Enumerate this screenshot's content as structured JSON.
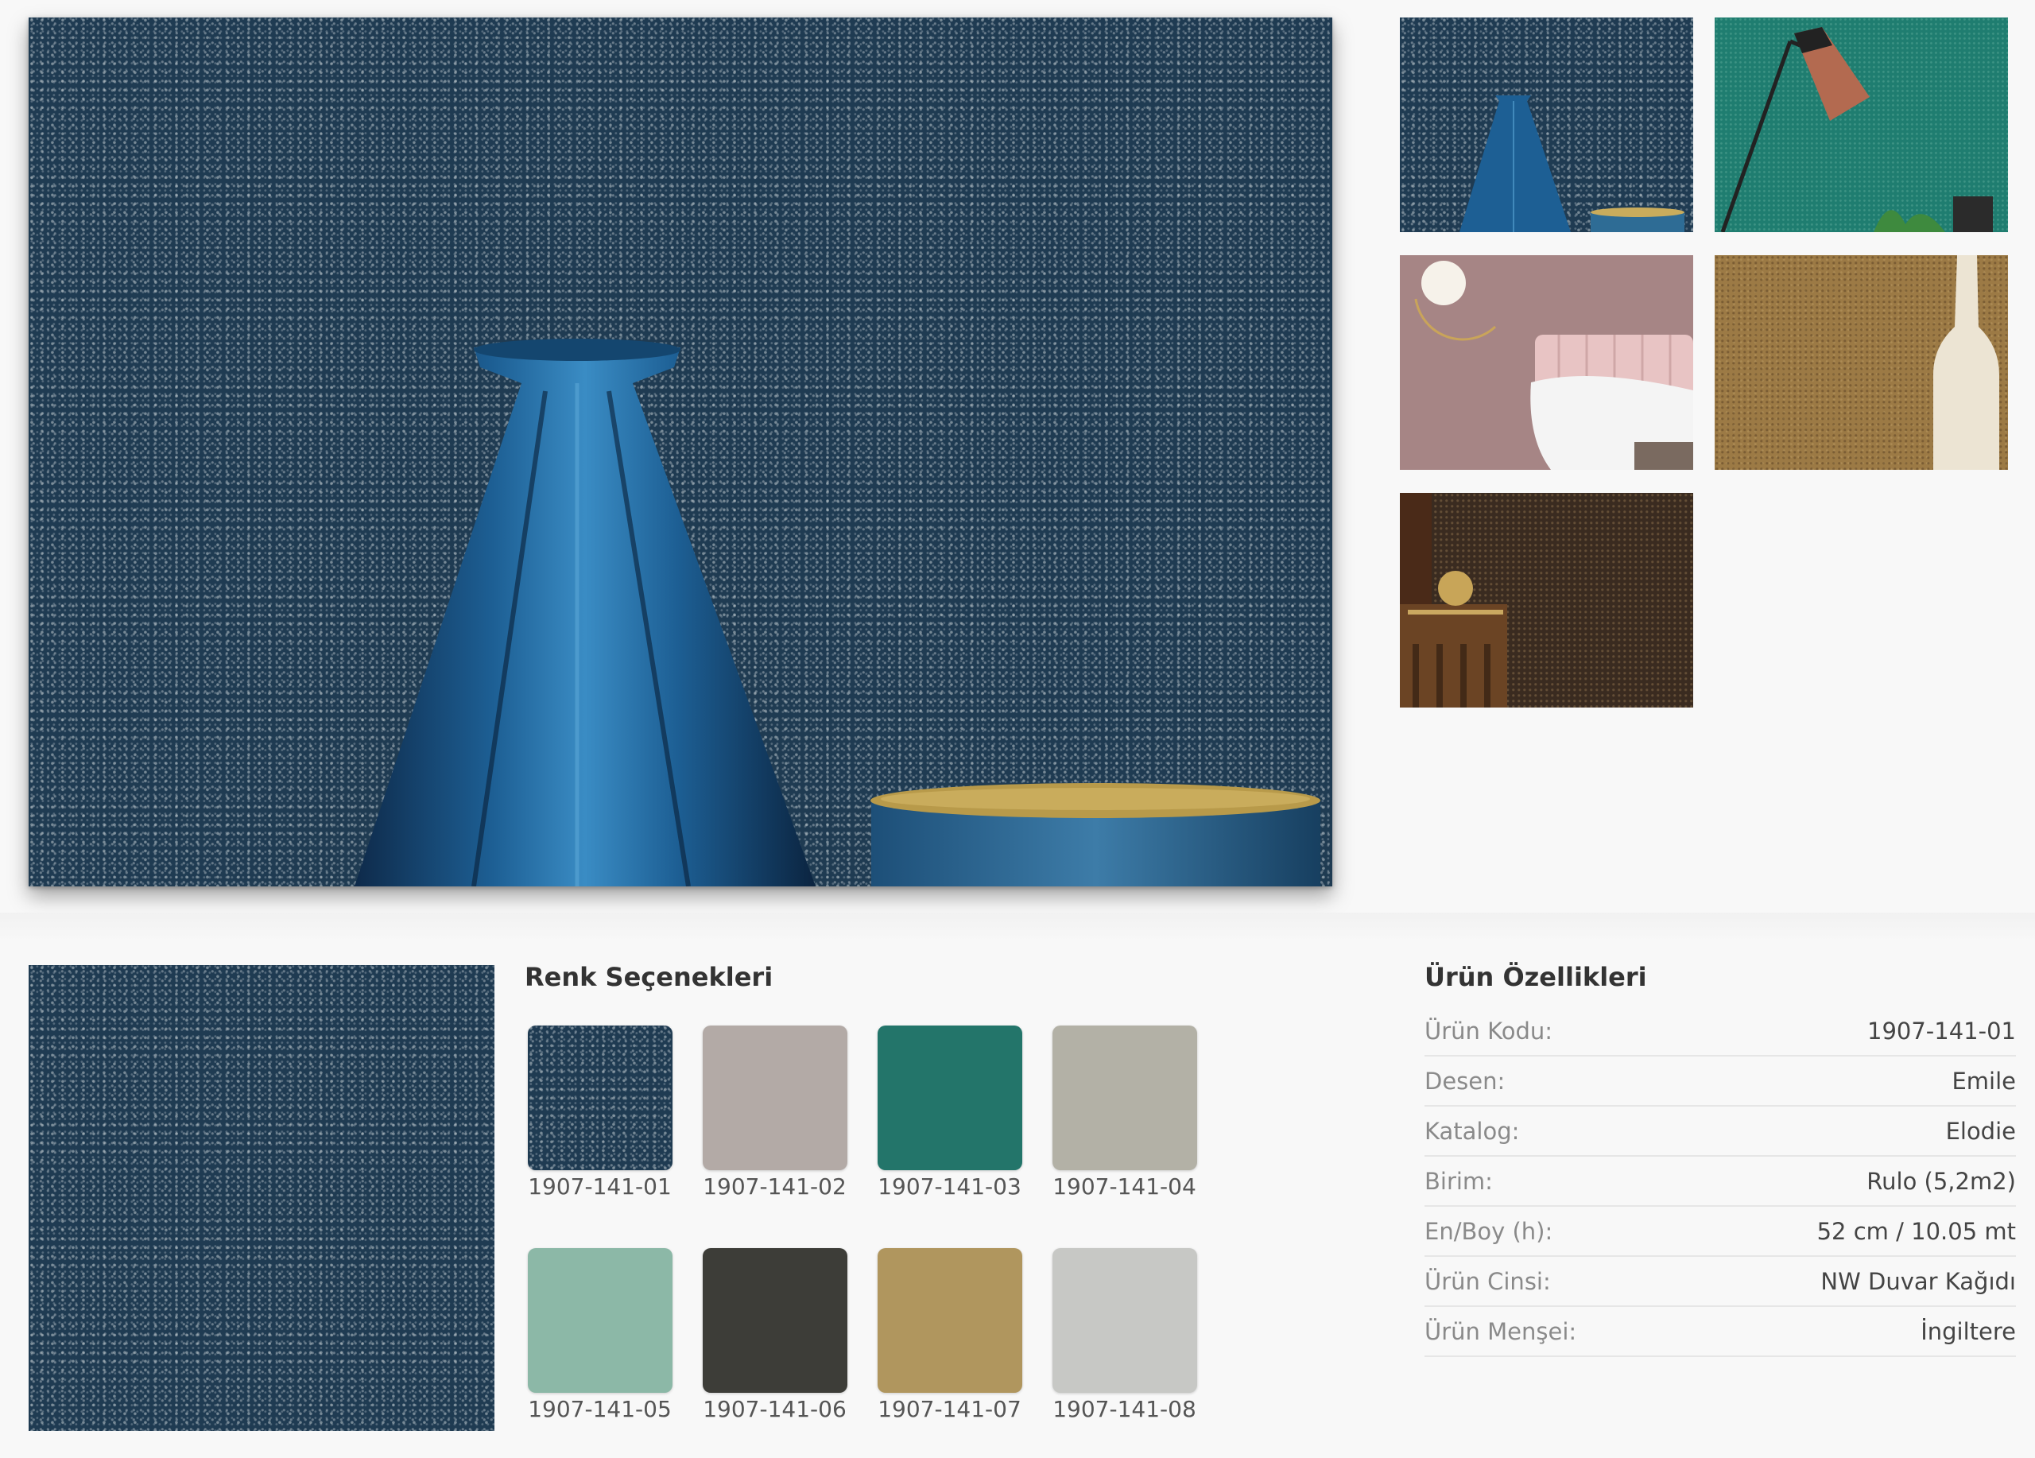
{
  "gallery": {
    "main_image": "wallpaper-crackle-blue-vase",
    "thumbnails": [
      {
        "name": "thumb-blue-vase",
        "color": "#1f3b52"
      },
      {
        "name": "thumb-green-lamp",
        "color": "#1f7d70"
      },
      {
        "name": "thumb-pink-bedroom",
        "color": "#a68585"
      },
      {
        "name": "thumb-gold-vase",
        "color": "#9c7a45"
      },
      {
        "name": "thumb-brown-jar",
        "color": "#3a2b20"
      }
    ]
  },
  "colors": {
    "title": "Renk Seçenekleri",
    "options": [
      {
        "code": "1907-141-01",
        "color": "#3e5466"
      },
      {
        "code": "1907-141-02",
        "color": "#b3aaa6"
      },
      {
        "code": "1907-141-03",
        "color": "#23756a"
      },
      {
        "code": "1907-141-04",
        "color": "#b3b1a6"
      },
      {
        "code": "1907-141-05",
        "color": "#8cb8a7"
      },
      {
        "code": "1907-141-06",
        "color": "#3d3d38"
      },
      {
        "code": "1907-141-07",
        "color": "#b0965e"
      },
      {
        "code": "1907-141-08",
        "color": "#c7c8c5"
      }
    ]
  },
  "specs": {
    "title": "Ürün Özellikleri",
    "rows": [
      {
        "label": "Ürün Kodu:",
        "value": "1907-141-01"
      },
      {
        "label": "Desen:",
        "value": "Emile"
      },
      {
        "label": "Katalog:",
        "value": "Elodie"
      },
      {
        "label": "Birim:",
        "value": "Rulo (5,2m2)"
      },
      {
        "label": "En/Boy (h):",
        "value": "52 cm / 10.05 mt"
      },
      {
        "label": "Ürün Cinsi:",
        "value": "NW Duvar Kağıdı"
      },
      {
        "label": "Ürün Menşei:",
        "value": "İngiltere"
      }
    ]
  }
}
